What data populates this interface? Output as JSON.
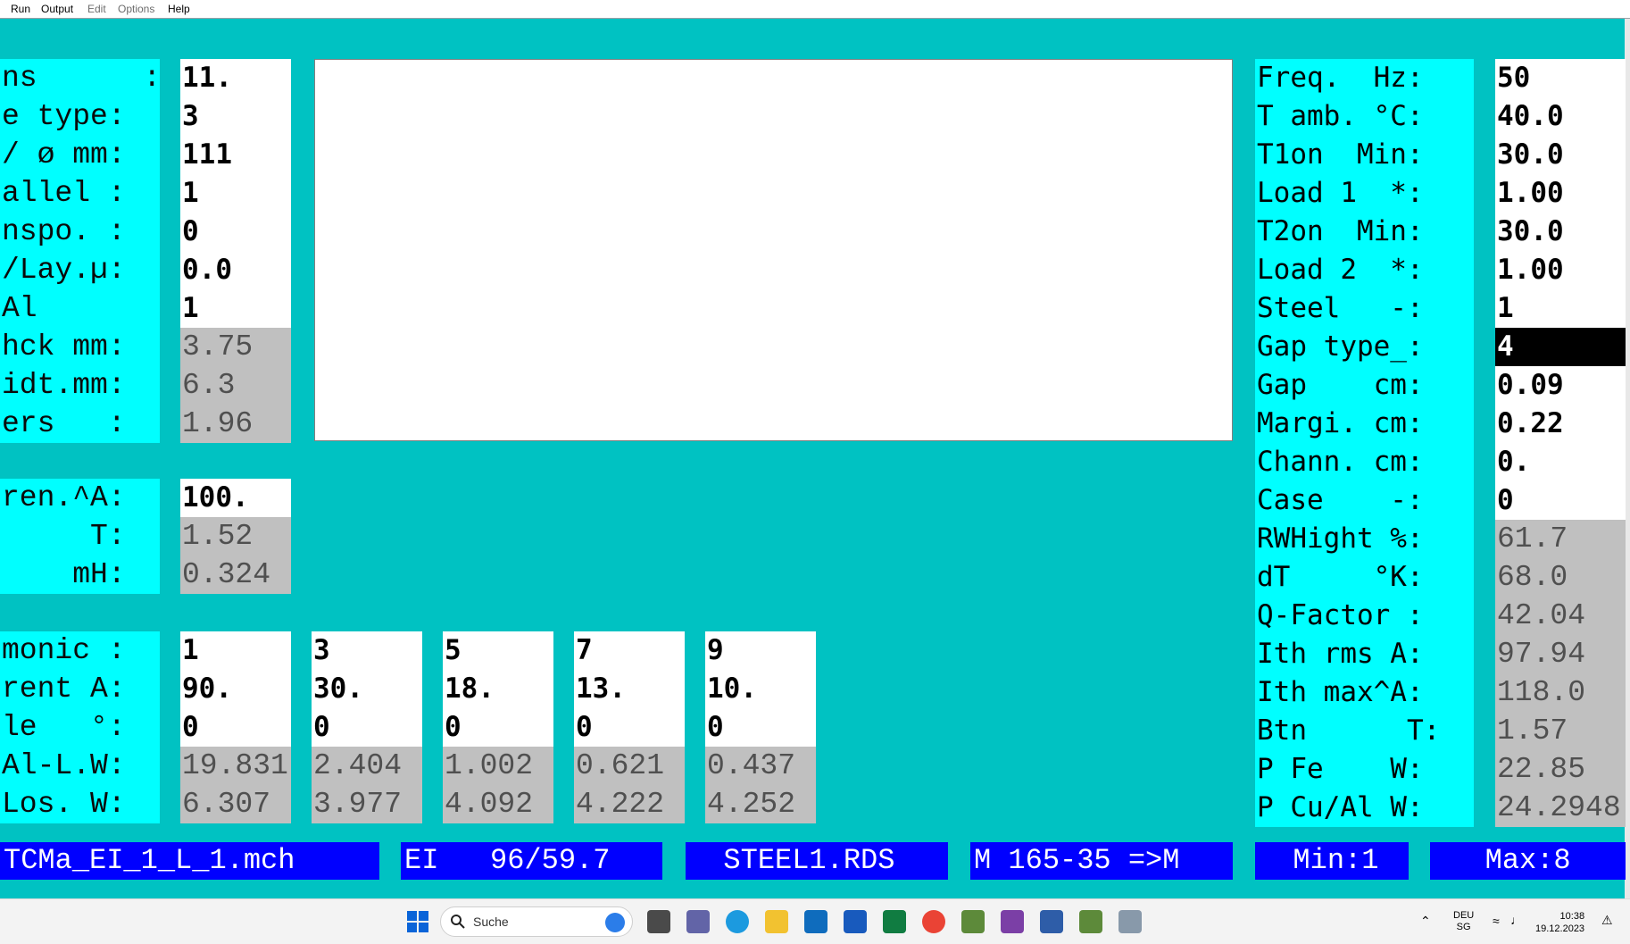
{
  "menu": [
    "Run",
    "Output",
    "Edit",
    "Options",
    "Help"
  ],
  "left_params": {
    "labels": [
      "ns      :",
      "e type:",
      "/ ø mm:",
      "allel :",
      "nspo. :",
      "/Lay.µ:",
      "Al",
      "hck mm:",
      "idt.mm:",
      "ers   :"
    ],
    "values": [
      "11.",
      "3",
      "111",
      "1",
      "0",
      "0.0",
      "1",
      "3.75",
      "6.3",
      "1.96"
    ]
  },
  "current": {
    "labels": [
      "ren.^A:",
      "     T:",
      "    mH:"
    ],
    "values": [
      "100.",
      "1.52",
      "0.324"
    ]
  },
  "harmonics": {
    "labels": [
      "monic :",
      "rent A:",
      "le   °:",
      "Al-L.W:",
      "Los. W:"
    ],
    "columns": [
      [
        "1",
        "90.",
        "0",
        "19.831",
        "6.307"
      ],
      [
        "3",
        "30.",
        "0",
        "2.404",
        "3.977"
      ],
      [
        "5",
        "18.",
        "0",
        "1.002",
        "4.092"
      ],
      [
        "7",
        "13.",
        "0",
        "0.621",
        "4.222"
      ],
      [
        "9",
        "10.",
        "0",
        "0.437",
        "4.252"
      ]
    ]
  },
  "right_params": {
    "labels": [
      "Freq.  Hz:",
      "T amb. °C:",
      "T1on  Min:",
      "Load 1  *:",
      "T2on  Min:",
      "Load 2  *:",
      "Steel   -:",
      "Gap type_:",
      "Gap    cm:",
      "Margi. cm:",
      "Chann. cm:",
      "Case    -:",
      "RWHight %:",
      "dT     °K:",
      "Q-Factor :",
      "Ith rms A:",
      "Ith max^A:",
      "Btn      T:",
      "P Fe    W:",
      "P Cu/Al W:"
    ],
    "values": [
      "50",
      "40.0",
      "30.0",
      "1.00",
      "30.0",
      "1.00",
      "1",
      "4",
      "0.09",
      "0.22",
      "0.",
      "0",
      "61.7",
      "68.0",
      "42.04",
      "97.94",
      "118.0",
      "1.57",
      "22.85",
      "24.2948"
    ],
    "selected_index": 7
  },
  "status_bar": [
    "TCMa_EI_1_L_1.mch",
    "EI   96/59.7",
    "  STEEL1.RDS",
    "M 165-35 =>M",
    "  Min:1",
    "   Max:8"
  ],
  "taskbar": {
    "search_placeholder": "Suche",
    "language": "DEU",
    "region": "SG",
    "time": "10:38",
    "date": "19.12.2023",
    "apps": [
      "windows-start-icon",
      "task-view-icon",
      "teams-icon",
      "edge-icon",
      "file-explorer-icon",
      "outlook-icon",
      "word-icon",
      "excel-icon",
      "chrome-icon",
      "z-app-icon",
      "visual-studio-icon",
      "a-app-icon",
      "z-app-icon-2",
      "active-app-icon"
    ]
  }
}
